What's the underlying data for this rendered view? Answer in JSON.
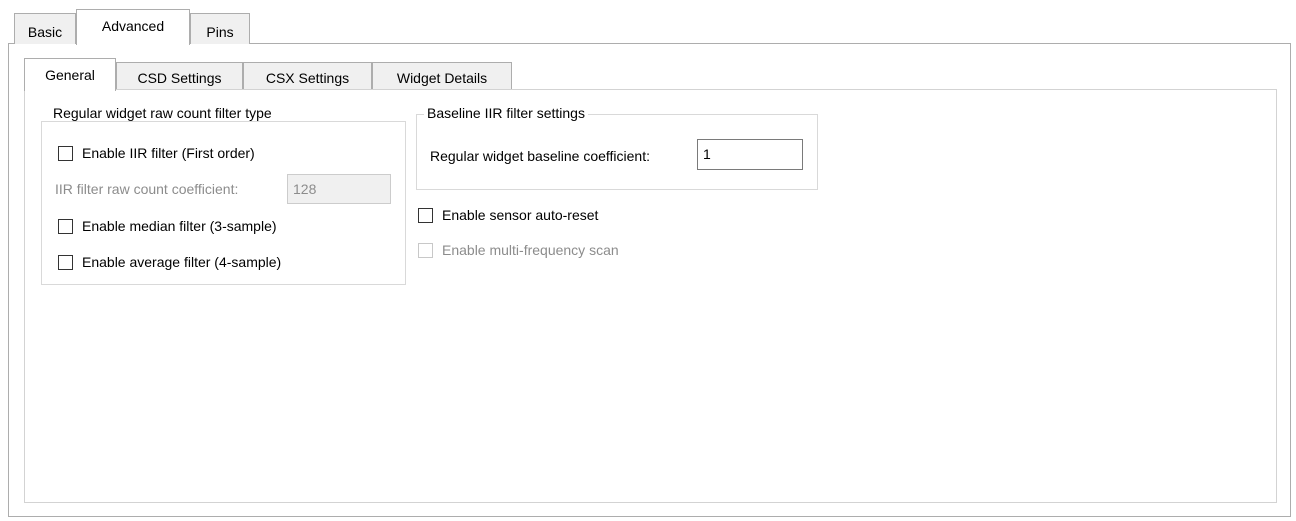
{
  "top_tabs": [
    "Basic",
    "Advanced",
    "Pins"
  ],
  "sub_tabs": [
    "General",
    "CSD Settings",
    "CSX Settings",
    "Widget Details"
  ],
  "raw_count_group": {
    "title": "Regular widget raw count filter type",
    "enable_iir": "Enable IIR filter (First order)",
    "iir_coeff_label": "IIR filter raw count coefficient:",
    "iir_coeff_value": "128",
    "enable_median": "Enable median filter (3-sample)",
    "enable_average": "Enable average filter (4-sample)"
  },
  "baseline_group": {
    "title": "Baseline IIR filter settings",
    "coeff_label": "Regular widget baseline coefficient:",
    "coeff_value": "1"
  },
  "options": {
    "auto_reset": "Enable sensor auto-reset",
    "multi_freq": "Enable multi-frequency scan"
  }
}
